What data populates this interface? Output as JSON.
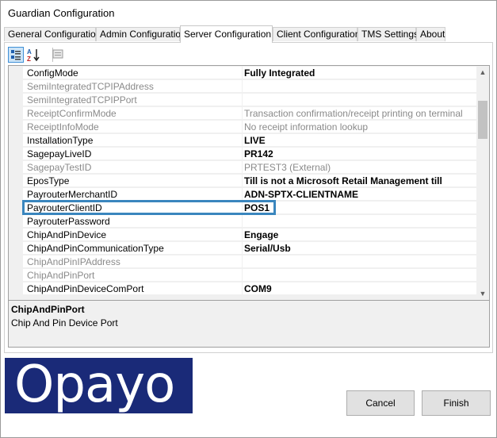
{
  "window": {
    "title": "Guardian Configuration"
  },
  "tabs": [
    {
      "label": "General Configuration"
    },
    {
      "label": "Admin Configuration"
    },
    {
      "label": "Server Configuration"
    },
    {
      "label": "Client Configuration"
    },
    {
      "label": "TMS Settings"
    },
    {
      "label": "About"
    }
  ],
  "active_tab": "Server Configuration",
  "toolbar": {
    "buttons": [
      {
        "icon": "categorized-view-icon",
        "pressed": true
      },
      {
        "icon": "alphabetical-sort-icon",
        "pressed": false
      },
      {
        "icon": "property-pages-icon",
        "pressed": false
      }
    ]
  },
  "properties": [
    {
      "name": "ConfigMode",
      "value": "Fully Integrated",
      "enabled": true
    },
    {
      "name": "SemiIntegratedTCPIPAddress",
      "value": "",
      "enabled": false
    },
    {
      "name": "SemiIntegratedTCPIPPort",
      "value": "",
      "enabled": false
    },
    {
      "name": "ReceiptConfirmMode",
      "value": "Transaction confirmation/receipt printing on terminal",
      "enabled": false
    },
    {
      "name": "ReceiptInfoMode",
      "value": "No receipt information lookup",
      "enabled": false
    },
    {
      "name": "InstallationType",
      "value": "LIVE",
      "enabled": true
    },
    {
      "name": "SagepayLiveID",
      "value": "PR142",
      "enabled": true
    },
    {
      "name": "SagepayTestID",
      "value": "PRTEST3 (External)",
      "enabled": false
    },
    {
      "name": "EposType",
      "value": "Till is not a Microsoft Retail Management till",
      "enabled": true
    },
    {
      "name": "PayrouterMerchantID",
      "value": "ADN-SPTX-CLIENTNAME",
      "enabled": true
    },
    {
      "name": "PayrouterClientID",
      "value": "POS1",
      "enabled": true
    },
    {
      "name": "PayrouterPassword",
      "value": "",
      "enabled": true
    },
    {
      "name": "ChipAndPinDevice",
      "value": "Engage",
      "enabled": true
    },
    {
      "name": "ChipAndPinCommunicationType",
      "value": "Serial/Usb",
      "enabled": true
    },
    {
      "name": "ChipAndPinIPAddress",
      "value": "",
      "enabled": false
    },
    {
      "name": "ChipAndPinPort",
      "value": "",
      "enabled": false
    },
    {
      "name": "ChipAndPinDeviceComPort",
      "value": "COM9",
      "enabled": true
    }
  ],
  "highlighted_property": "PayrouterClientID",
  "scrollbar": {
    "up_icon": "scroll-up-arrow-icon",
    "down_icon": "scroll-down-arrow-icon"
  },
  "description": {
    "title": "ChipAndPinPort",
    "text": "Chip And Pin Device Port"
  },
  "logo": {
    "text": "Opayo",
    "background": "#1a2a78",
    "color": "#ffffff"
  },
  "buttons": {
    "cancel": "Cancel",
    "finish": "Finish"
  },
  "colors": {
    "highlight_border": "#3a86be",
    "disabled_text": "#8a8a8a"
  }
}
